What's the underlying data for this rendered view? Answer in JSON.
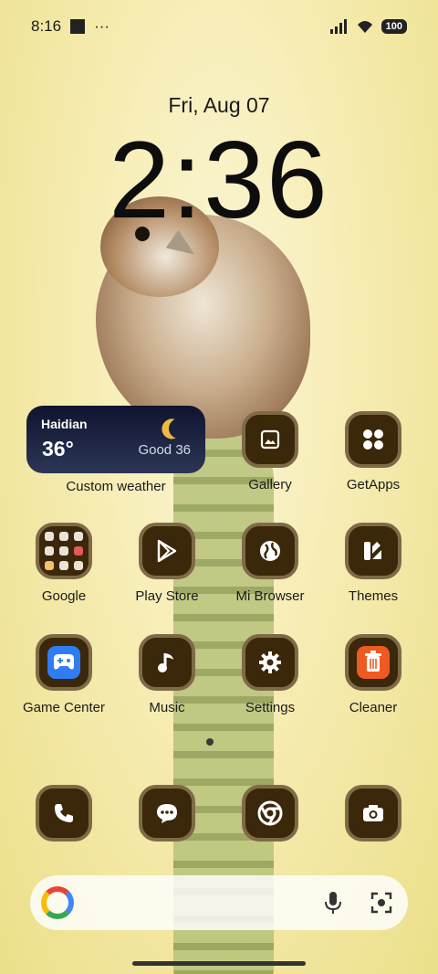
{
  "status_bar": {
    "time": "8:16",
    "overflow": "···",
    "battery": "100"
  },
  "lock": {
    "date": "Fri, Aug 07",
    "clock": "2:36"
  },
  "weather": {
    "city": "Haidian",
    "temp": "36°",
    "aqi": "Good 36",
    "label": "Custom weather",
    "icon": "moon-icon",
    "moon_color": "#f0b940"
  },
  "apps": {
    "gallery": "Gallery",
    "getapps": "GetApps",
    "google": "Google",
    "play_store": "Play Store",
    "mi_browser": "Mi Browser",
    "themes": "Themes",
    "game_center": "Game Center",
    "music": "Music",
    "settings": "Settings",
    "cleaner": "Cleaner"
  },
  "dock": [
    "phone-icon",
    "messages-icon",
    "chrome-icon",
    "camera-icon"
  ],
  "search": {
    "logo": "google-g-icon",
    "mic": "mic-icon",
    "lens": "lens-icon"
  },
  "colors": {
    "icon_bg": "#3b2709",
    "icon_border": "#7f6a47",
    "wallpaper": "#f4eaa6"
  }
}
